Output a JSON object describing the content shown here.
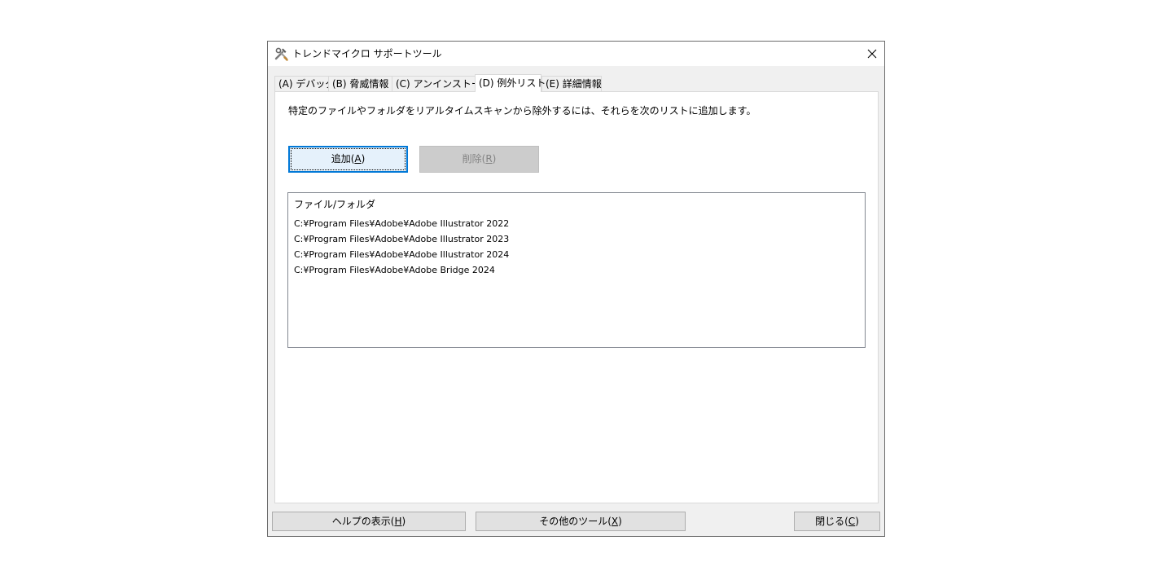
{
  "window": {
    "title": "トレンドマイクロ サポートツール",
    "icon": "tools-icon",
    "close_icon": "close-icon"
  },
  "tabs": [
    {
      "label": "(A) デバッグ",
      "active": false
    },
    {
      "label": "(B) 脅威情報",
      "active": false
    },
    {
      "label": "(C) アンインストール",
      "active": false
    },
    {
      "label": "(D) 例外リスト",
      "active": true
    },
    {
      "label": "(E) 詳細情報",
      "active": false
    }
  ],
  "panel": {
    "instruction": "特定のファイルやフォルダをリアルタイムスキャンから除外するには、それらを次のリストに追加します。",
    "add_button": {
      "label": "追加(",
      "mnemonic": "A",
      "suffix": ")"
    },
    "delete_button": {
      "label": "削除(",
      "mnemonic": "R",
      "suffix": ")",
      "disabled": true
    },
    "list": {
      "header": "ファイル/フォルダ",
      "items": [
        "C:¥Program Files¥Adobe¥Adobe Illustrator 2022",
        "C:¥Program Files¥Adobe¥Adobe Illustrator 2023",
        "C:¥Program Files¥Adobe¥Adobe Illustrator 2024",
        "C:¥Program Files¥Adobe¥Adobe Bridge 2024"
      ]
    }
  },
  "footer": {
    "help": {
      "label": "ヘルプの表示(",
      "mnemonic": "H",
      "suffix": ")"
    },
    "other_tools": {
      "label": "その他のツール(",
      "mnemonic": "X",
      "suffix": ")"
    },
    "close": {
      "label": "閉じる(",
      "mnemonic": "C",
      "suffix": ")"
    }
  },
  "colors": {
    "focus_border": "#0078d7",
    "window_bg": "#f0f0f0",
    "panel_bg": "#ffffff"
  }
}
